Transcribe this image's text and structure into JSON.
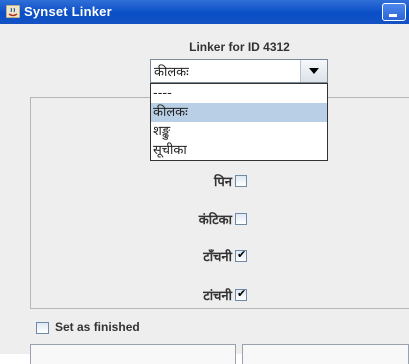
{
  "window": {
    "title": "Synset Linker",
    "icons": {
      "app": "java-cup-icon",
      "minimize": "minimize-icon"
    }
  },
  "heading": "Linker for ID 4312",
  "combo": {
    "selected": "कीलकः",
    "options": [
      "----",
      "कीलकः",
      "शङ्कु",
      "सूचीका"
    ],
    "highlighted_index": 1
  },
  "options": [
    {
      "label": "पिन",
      "checked": false
    },
    {
      "label": "कंटिका",
      "checked": false
    },
    {
      "label": "टाँचनी",
      "checked": true
    },
    {
      "label": "टांचनी",
      "checked": true
    }
  ],
  "finished": {
    "label": "Set as finished",
    "checked": false
  },
  "check_mark": "✔"
}
